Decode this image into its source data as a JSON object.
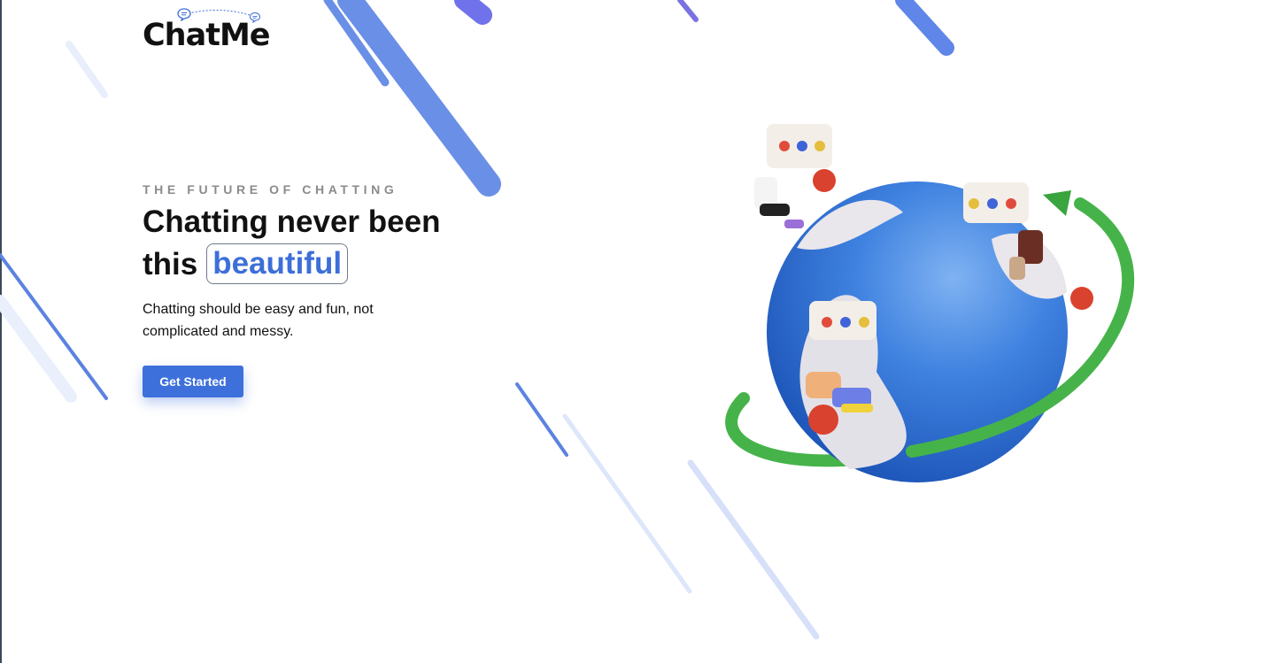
{
  "brand": {
    "name": "ChatMe"
  },
  "hero": {
    "eyebrow": "THE FUTURE OF CHATTING",
    "headline_line1": "Chatting never been",
    "headline_word": "this",
    "headline_highlight": "beautiful",
    "subtitle": "Chatting should be easy and fun, not complicated and messy.",
    "cta_label": "Get Started"
  },
  "colors": {
    "accent": "#3e70dc",
    "stripe_light": "#dce6fb",
    "globe": "#2f6fd8",
    "ring": "#4cb84a"
  },
  "icons": [
    "chat-bubble-icon",
    "globe-illustration"
  ]
}
